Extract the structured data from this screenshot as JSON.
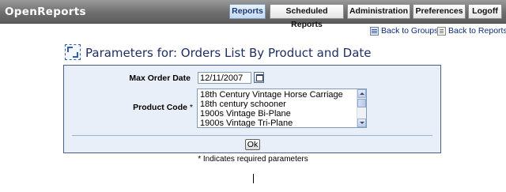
{
  "app": {
    "title": "OpenReports"
  },
  "nav": {
    "reports": "Reports",
    "scheduled_reports": "Scheduled Reports",
    "administration": "Administration",
    "preferences": "Preferences",
    "logoff": "Logoff",
    "active": "Reports"
  },
  "links": {
    "back_to_groups": "Back to Groups",
    "back_to_reports": "Back to Reports"
  },
  "page": {
    "title": "Parameters for: Orders List By Product and Date"
  },
  "form": {
    "max_order_date_label": "Max Order Date",
    "max_order_date_value": "12/11/2007",
    "product_code_label": "Product Code",
    "required_marker": "*",
    "product_options": [
      "18th Century Vintage Horse Carriage",
      "18th century schooner",
      "1900s Vintage Bi-Plane",
      "1900s Vintage Tri-Plane"
    ],
    "ok_label": "Ok"
  },
  "footer": {
    "required_note": "* Indicates required parameters"
  },
  "colors": {
    "topbar": "#6e6e6e",
    "panel_bg": "#e9eff8",
    "panel_border": "#4c5f8a",
    "title": "#1f2f66",
    "link": "#0b2d7a"
  },
  "icons": {
    "back_to_groups": "list-icon",
    "back_to_reports": "document-icon",
    "title": "parameters-icon",
    "calendar": "calendar-icon"
  }
}
